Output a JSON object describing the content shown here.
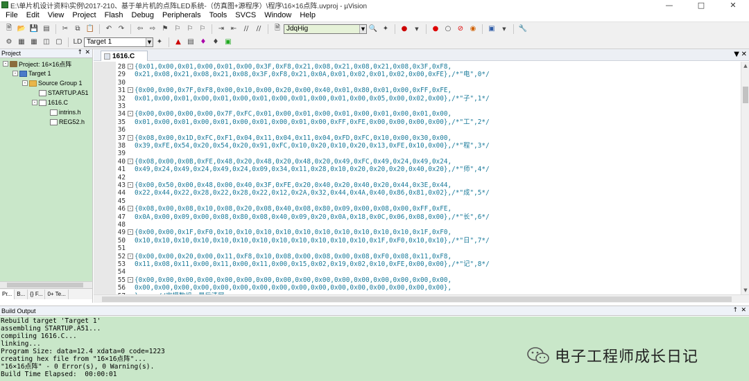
{
  "window": {
    "title": "E:\\单片机设计资料\\实例\\2017-210、基于单片机的点阵LED系统-（仿真图+源程序）\\程序\\16×16点阵.uvproj - µVision"
  },
  "menu": [
    "File",
    "Edit",
    "View",
    "Project",
    "Flash",
    "Debug",
    "Peripherals",
    "Tools",
    "SVCS",
    "Window",
    "Help"
  ],
  "toolbar": {
    "find_value": "JdqHig",
    "target_value": "Target 1"
  },
  "project_panel": {
    "title": "Project",
    "tree": [
      {
        "label": "Project: 16×16点阵",
        "level": 0,
        "icon": "project-icon"
      },
      {
        "label": "Target 1",
        "level": 1,
        "icon": "target-icon"
      },
      {
        "label": "Source Group 1",
        "level": 2,
        "icon": "folder-icon"
      },
      {
        "label": "STARTUP.A51",
        "level": 3,
        "icon": "file-icon"
      },
      {
        "label": "1616.C",
        "level": 3,
        "icon": "file-icon"
      },
      {
        "label": "intrins.h",
        "level": 4,
        "icon": "file-icon"
      },
      {
        "label": "REG52.h",
        "level": 4,
        "icon": "file-icon"
      }
    ],
    "tabs": [
      "Pr...",
      "B...",
      "{} F...",
      "0+ Te..."
    ]
  },
  "editor": {
    "active_tab": "1616.C",
    "lines": [
      {
        "num": "28",
        "fold": true,
        "text": "{0x01,0x00,0x01,0x00,0x01,0x00,0x3F,0xF8,0x21,0x08,0x21,0x08,0x21,0x08,0x3F,0xF8,"
      },
      {
        "num": "29",
        "fold": false,
        "text": "0x21,0x08,0x21,0x08,0x21,0x08,0x3F,0xF8,0x21,0x0A,0x01,0x02,0x01,0x02,0x00,0xFE},/*\"电\",0*/"
      },
      {
        "num": "30",
        "fold": false,
        "text": ""
      },
      {
        "num": "31",
        "fold": true,
        "text": "{0x00,0x00,0x7F,0xF8,0x00,0x10,0x00,0x20,0x00,0x40,0x01,0x80,0x01,0x00,0xFF,0xFE,"
      },
      {
        "num": "32",
        "fold": false,
        "text": "0x01,0x00,0x01,0x00,0x01,0x00,0x01,0x00,0x01,0x00,0x01,0x00,0x05,0x00,0x02,0x00},/*\"子\",1*/"
      },
      {
        "num": "33",
        "fold": false,
        "text": ""
      },
      {
        "num": "34",
        "fold": true,
        "text": "{0x00,0x00,0x00,0x00,0x7F,0xFC,0x01,0x00,0x01,0x00,0x01,0x00,0x01,0x00,0x01,0x00,"
      },
      {
        "num": "35",
        "fold": false,
        "text": "0x01,0x00,0x01,0x00,0x01,0x00,0x01,0x00,0x01,0x00,0xFF,0xFE,0x00,0x00,0x00,0x00},/*\"工\",2*/"
      },
      {
        "num": "36",
        "fold": false,
        "text": ""
      },
      {
        "num": "37",
        "fold": true,
        "text": "{0x08,0x00,0x1D,0xFC,0xF1,0x04,0x11,0x04,0x11,0x04,0xFD,0xFC,0x10,0x00,0x30,0x00,"
      },
      {
        "num": "38",
        "fold": false,
        "text": "0x39,0xFE,0x54,0x20,0x54,0x20,0x91,0xFC,0x10,0x20,0x10,0x20,0x13,0xFE,0x10,0x00},/*\"程\",3*/"
      },
      {
        "num": "39",
        "fold": false,
        "text": ""
      },
      {
        "num": "40",
        "fold": true,
        "text": "{0x08,0x00,0x0B,0xFE,0x48,0x20,0x48,0x20,0x48,0x20,0x49,0xFC,0x49,0x24,0x49,0x24,"
      },
      {
        "num": "41",
        "fold": false,
        "text": "0x49,0x24,0x49,0x24,0x49,0x24,0x09,0x34,0x11,0x28,0x10,0x20,0x20,0x20,0x40,0x20},/*\"师\",4*/"
      },
      {
        "num": "42",
        "fold": false,
        "text": ""
      },
      {
        "num": "43",
        "fold": true,
        "text": "{0x00,0x50,0x00,0x48,0x00,0x40,0x3F,0xFE,0x20,0x40,0x20,0x40,0x20,0x44,0x3E,0x44,"
      },
      {
        "num": "44",
        "fold": false,
        "text": "0x22,0x44,0x22,0x28,0x22,0x28,0x22,0x12,0x2A,0x32,0x44,0x4A,0x40,0x86,0x81,0x02},/*\"成\",5*/"
      },
      {
        "num": "45",
        "fold": false,
        "text": ""
      },
      {
        "num": "46",
        "fold": true,
        "text": "{0x08,0x00,0x08,0x10,0x08,0x20,0x08,0x40,0x08,0x80,0x09,0x00,0x08,0x00,0xFF,0xFE,"
      },
      {
        "num": "47",
        "fold": false,
        "text": "0x0A,0x00,0x09,0x00,0x08,0x80,0x08,0x40,0x09,0x20,0x0A,0x18,0x0C,0x06,0x08,0x00},/*\"长\",6*/"
      },
      {
        "num": "48",
        "fold": false,
        "text": ""
      },
      {
        "num": "49",
        "fold": true,
        "text": "{0x00,0x00,0x1F,0xF0,0x10,0x10,0x10,0x10,0x10,0x10,0x10,0x10,0x10,0x10,0x1F,0xF0,"
      },
      {
        "num": "50",
        "fold": false,
        "text": "0x10,0x10,0x10,0x10,0x10,0x10,0x10,0x10,0x10,0x10,0x10,0x10,0x1F,0xF0,0x10,0x10},/*\"日\",7*/"
      },
      {
        "num": "51",
        "fold": false,
        "text": ""
      },
      {
        "num": "52",
        "fold": true,
        "text": "{0x00,0x00,0x20,0x00,0x11,0xF8,0x10,0x08,0x00,0x08,0x00,0x08,0xF0,0x08,0x11,0xF8,"
      },
      {
        "num": "53",
        "fold": false,
        "text": "0x11,0x08,0x11,0x00,0x11,0x00,0x11,0x00,0x15,0x02,0x19,0x02,0x10,0xFE,0x00,0x00},/*\"记\",8*/"
      },
      {
        "num": "54",
        "fold": false,
        "text": ""
      },
      {
        "num": "55",
        "fold": true,
        "text": "{0x00,0x00,0x00,0x00,0x00,0x00,0x00,0x00,0x00,0x00,0x00,0x00,0x00,0x00,0x00,0x00,"
      },
      {
        "num": "56",
        "fold": false,
        "text": "0x00,0x00,0x00,0x00,0x00,0x00,0x00,0x00,0x00,0x00,0x00,0x00,0x00,0x00,0x00,0x00},"
      },
      {
        "num": "57",
        "fold": false,
        "text": "};    //字模数组，最后清屏"
      }
    ]
  },
  "build_output": {
    "title": "Build Output",
    "lines": [
      "Rebuild target 'Target 1'",
      "assembling STARTUP.A51...",
      "compiling 1616.C...",
      "linking...",
      "Program Size: data=12.4 xdata=0 code=1223",
      "creating hex file from \"16×16点阵\"...",
      "\"16×16点阵\" - 0 Error(s), 0 Warning(s).",
      "Build Time Elapsed:  00:00:01"
    ]
  },
  "watermark": {
    "text": "电子工程师成长日记"
  },
  "colors": {
    "tree_bg": "#c9e7c9",
    "code_text": "#1a7a9a",
    "build_bg": "#c9e7c9"
  }
}
